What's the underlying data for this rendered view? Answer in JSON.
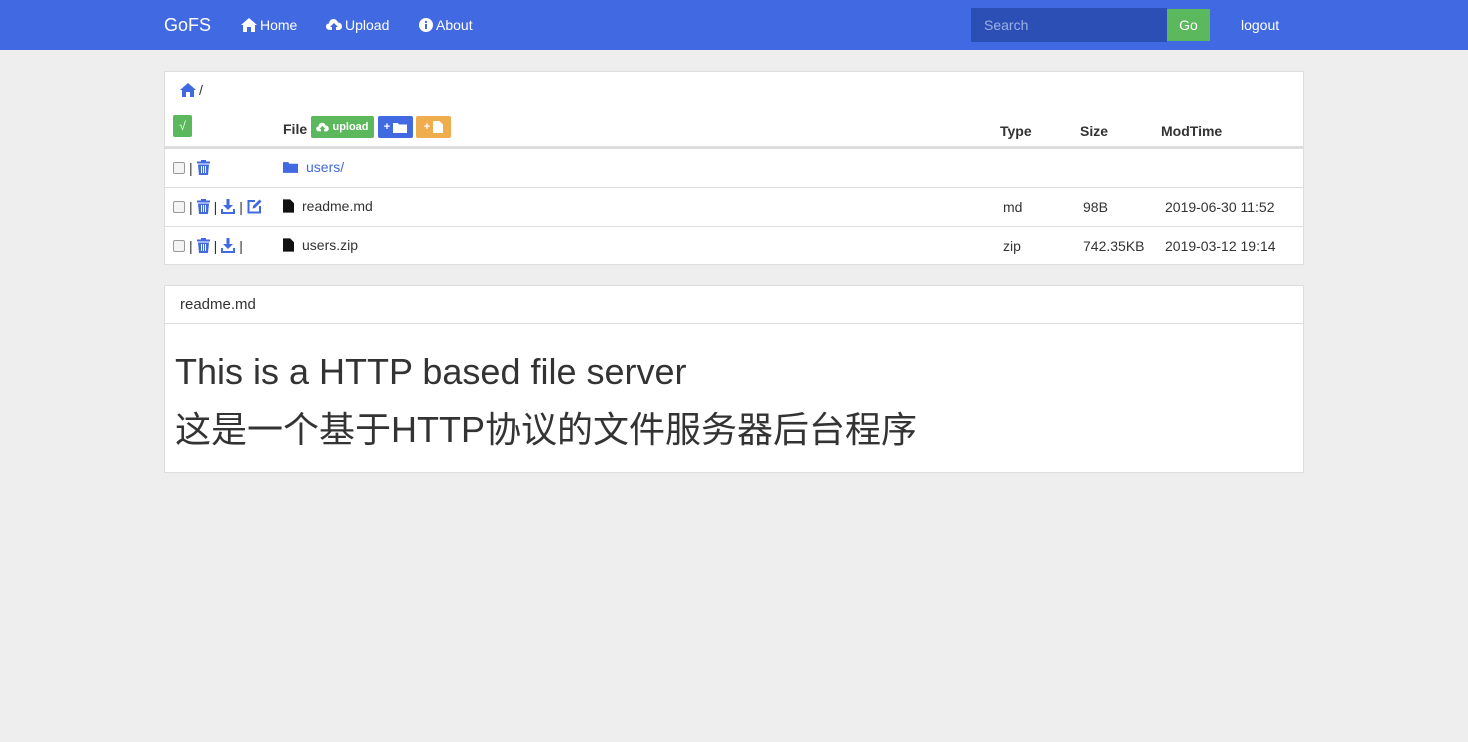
{
  "nav": {
    "brand": "GoFS",
    "home": "Home",
    "upload": "Upload",
    "about": "About",
    "search_placeholder": "Search",
    "go": "Go",
    "logout": "logout"
  },
  "breadcrumb": {
    "sep": "/"
  },
  "table": {
    "select_all": "√",
    "headers": {
      "file": "File",
      "type": "Type",
      "size": "Size",
      "modtime": "ModTime"
    },
    "upload_btn": "upload",
    "new_folder_btn": "+",
    "new_file_btn": "+",
    "rows": [
      {
        "name": "users/",
        "type": "",
        "size": "",
        "modtime": ""
      },
      {
        "name": "readme.md",
        "type": "md",
        "size": "98B",
        "modtime": "2019-06-30 11:52"
      },
      {
        "name": "users.zip",
        "type": "zip",
        "size": "742.35KB",
        "modtime": "2019-03-12 19:14"
      }
    ]
  },
  "readme": {
    "title": "readme.md",
    "line1": "This is a HTTP based file server",
    "line2": "这是一个基于HTTP协议的文件服务器后台程序"
  },
  "colors": {
    "primary": "#4169e1",
    "success": "#5cb85c",
    "warning": "#f0ad4e"
  },
  "icons": [
    "home-icon",
    "cloud-upload-icon",
    "info-icon",
    "folder-icon",
    "file-icon",
    "trash-icon",
    "download-icon",
    "edit-icon"
  ]
}
